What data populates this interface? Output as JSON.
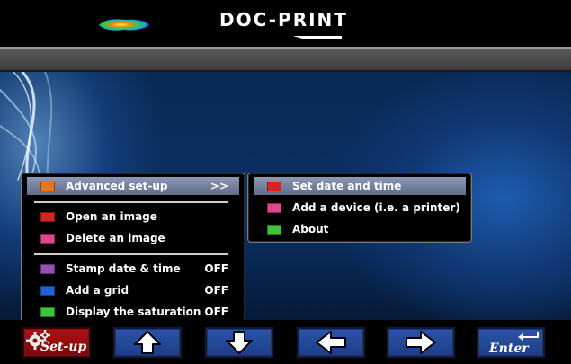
{
  "header": {
    "logo_icon": "heatmap-logo-icon",
    "brand": "DOC-PRINT"
  },
  "main_menu": {
    "items": [
      {
        "label": "Advanced set-up",
        "value": ">>",
        "color": "#e8741c",
        "selected": true
      },
      {
        "label": "Open an image",
        "value": "",
        "color": "#d42424",
        "selected": false
      },
      {
        "label": "Delete an image",
        "value": "",
        "color": "#e0478a",
        "selected": false
      },
      {
        "label": "Stamp date & time",
        "value": "OFF",
        "color": "#9a4fb8",
        "selected": false
      },
      {
        "label": "Add a grid",
        "value": "OFF",
        "color": "#1f62d6",
        "selected": false
      },
      {
        "label": "Display the saturation",
        "value": "OFF",
        "color": "#3cc43a",
        "selected": false
      }
    ]
  },
  "sub_menu": {
    "items": [
      {
        "label": "Set date and time",
        "color": "#d42424",
        "selected": true
      },
      {
        "label": "Add a device (i.e. a printer)",
        "color": "#e0478a",
        "selected": false
      },
      {
        "label": "About",
        "color": "#3cc43a",
        "selected": false
      }
    ]
  },
  "buttons": {
    "setup": {
      "label": "Set-up",
      "icon": "gears-icon"
    },
    "up": {
      "icon": "arrow-up-icon"
    },
    "down": {
      "icon": "arrow-down-icon"
    },
    "left": {
      "icon": "arrow-left-icon"
    },
    "right": {
      "icon": "arrow-right-icon"
    },
    "enter": {
      "label": "Enter",
      "icon": "return-icon"
    }
  }
}
